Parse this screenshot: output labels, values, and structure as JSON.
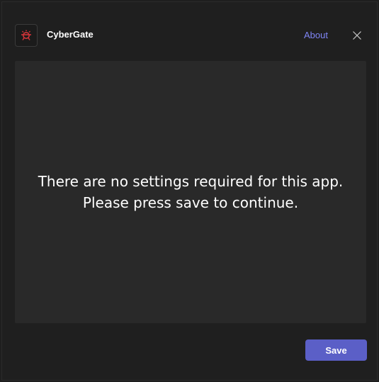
{
  "header": {
    "app_name": "CyberGate",
    "about_label": "About",
    "logo_icon": "cybergate-logo-icon",
    "close_icon": "close-icon"
  },
  "content": {
    "message": "There are no settings required for this app. Please press save to continue."
  },
  "footer": {
    "save_label": "Save"
  },
  "colors": {
    "background": "#1f1f1f",
    "panel": "#292929",
    "accent": "#5b5fc7",
    "link": "#7f85f5",
    "logo": "#d13438"
  }
}
